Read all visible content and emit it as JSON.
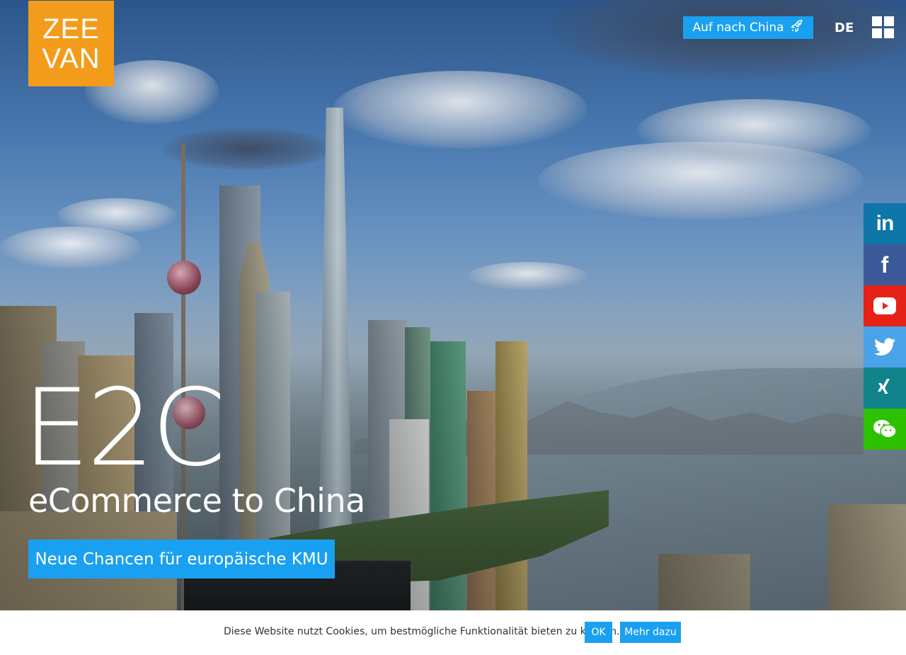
{
  "logo": {
    "line1": "ZEE",
    "line2": "VAN",
    "color": "#f39c1b"
  },
  "header": {
    "cta_label": "Auf nach China",
    "cta_icon": "rocket-icon",
    "language": "DE",
    "menu_icon": "grid-menu-icon",
    "accent": "#1aa0f0"
  },
  "social": [
    {
      "name": "linkedin",
      "icon": "linkedin-icon",
      "color": "#0e76a8"
    },
    {
      "name": "facebook",
      "icon": "facebook-icon",
      "color": "#3b5998"
    },
    {
      "name": "youtube",
      "icon": "youtube-icon",
      "color": "#e62117"
    },
    {
      "name": "twitter",
      "icon": "twitter-icon",
      "color": "#4aa3e8"
    },
    {
      "name": "xing",
      "icon": "xing-icon",
      "color": "#12838a"
    },
    {
      "name": "wechat",
      "icon": "wechat-icon",
      "color": "#2dc100"
    }
  ],
  "hero": {
    "title": "E2C",
    "subtitle": "eCommerce to China",
    "button_label": "Neue Chancen für europäische KMU"
  },
  "cookie": {
    "text": "Diese Website nutzt Cookies, um bestmögliche Funktionalität bieten zu können.",
    "ok_label": "OK",
    "more_label": "Mehr dazu"
  }
}
